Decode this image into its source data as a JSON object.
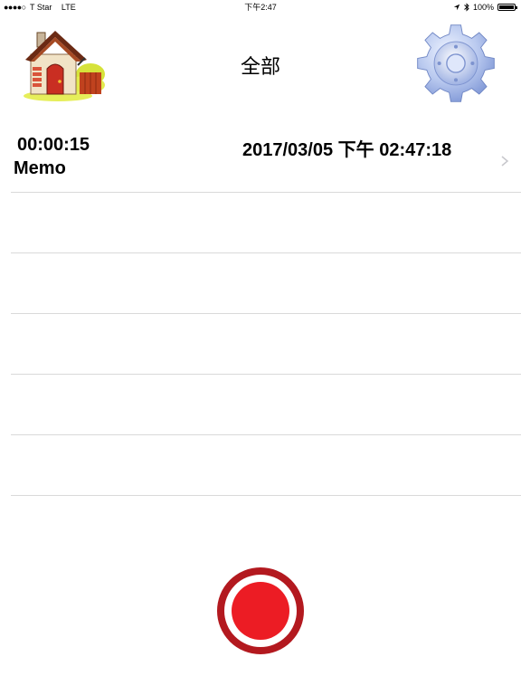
{
  "status_bar": {
    "signal_dots": "●●●●○",
    "carrier": "T Star",
    "network": "LTE",
    "time": "下午2:47",
    "battery": "100%"
  },
  "header": {
    "title": "全部",
    "home_icon": "house-icon",
    "settings_icon": "gear-icon"
  },
  "recordings": [
    {
      "duration": "00:00:15",
      "datetime": "2017/03/05 下午 02:47:18",
      "name": "Memo"
    }
  ],
  "record_button": {
    "icon": "record-icon",
    "color": "#ec1c24",
    "ring_color": "#b3191f"
  },
  "colors": {
    "separator": "#d9d9d9",
    "chevron": "#c7c7cc"
  }
}
